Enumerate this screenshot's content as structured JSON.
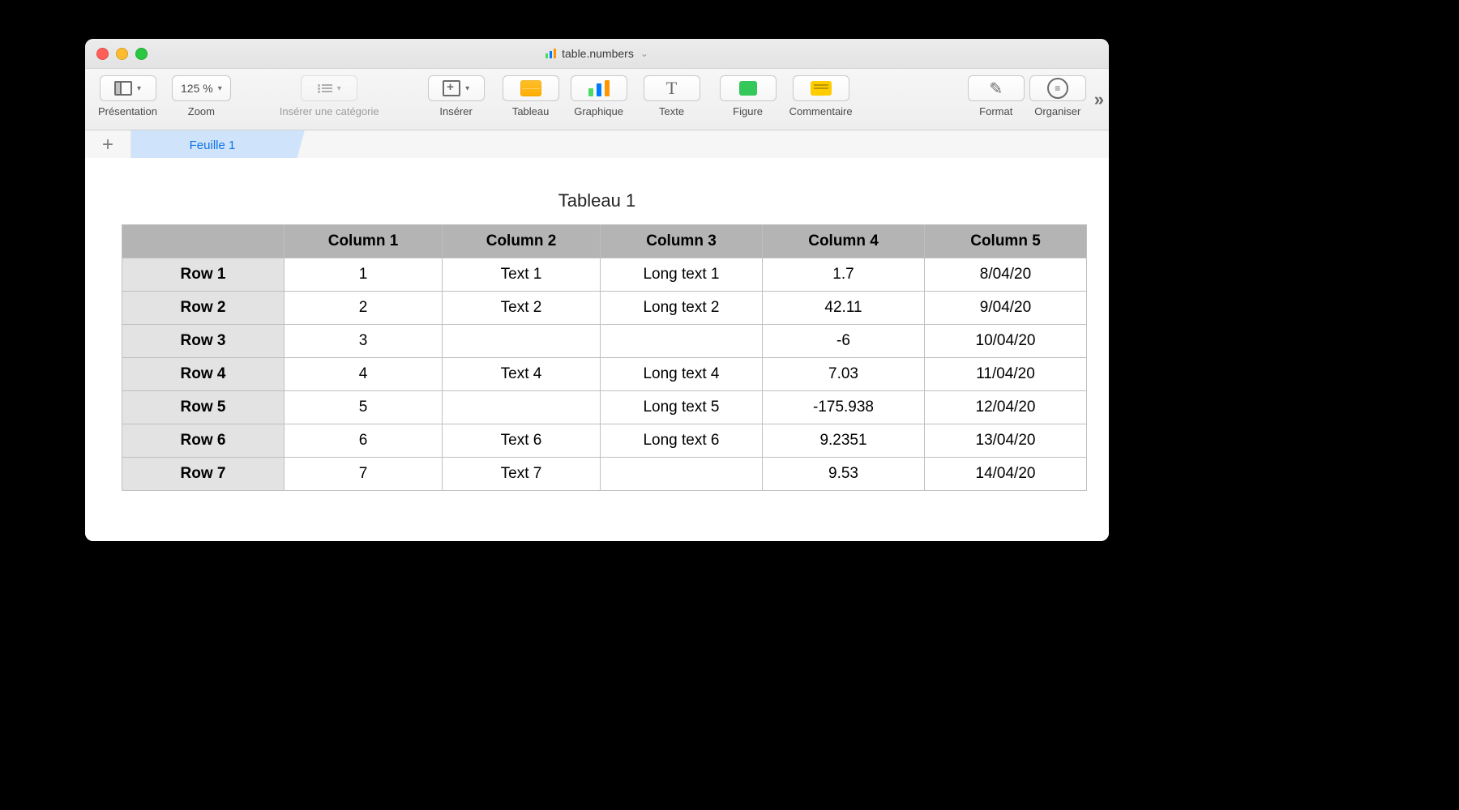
{
  "window": {
    "title": "table.numbers"
  },
  "toolbar": {
    "view": "Présentation",
    "zoom_value": "125 %",
    "zoom_label": "Zoom",
    "category": "Insérer une catégorie",
    "insert": "Insérer",
    "table": "Tableau",
    "chart": "Graphique",
    "text": "Texte",
    "shape": "Figure",
    "comment": "Commentaire",
    "format": "Format",
    "organize": "Organiser"
  },
  "tabs": {
    "sheet1": "Feuille 1"
  },
  "table": {
    "title": "Tableau 1",
    "columns": [
      "Column 1",
      "Column 2",
      "Column 3",
      "Column 4",
      "Column 5"
    ],
    "rows": [
      {
        "label": "Row 1",
        "cells": [
          "1",
          "Text 1",
          "Long text 1",
          "1.7",
          "8/04/20"
        ]
      },
      {
        "label": "Row 2",
        "cells": [
          "2",
          "Text 2",
          "Long text 2",
          "42.11",
          "9/04/20"
        ]
      },
      {
        "label": "Row 3",
        "cells": [
          "3",
          "",
          "",
          "-6",
          "10/04/20"
        ]
      },
      {
        "label": "Row 4",
        "cells": [
          "4",
          "Text 4",
          "Long text 4",
          "7.03",
          "11/04/20"
        ]
      },
      {
        "label": "Row 5",
        "cells": [
          "5",
          "",
          "Long text 5",
          "-175.938",
          "12/04/20"
        ]
      },
      {
        "label": "Row 6",
        "cells": [
          "6",
          "Text 6",
          "Long text 6",
          "9.2351",
          "13/04/20"
        ]
      },
      {
        "label": "Row 7",
        "cells": [
          "7",
          "Text 7",
          "",
          "9.53",
          "14/04/20"
        ]
      }
    ]
  },
  "chart_data": {
    "type": "table",
    "title": "Tableau 1",
    "columns": [
      "",
      "Column 1",
      "Column 2",
      "Column 3",
      "Column 4",
      "Column 5"
    ],
    "rows": [
      [
        "Row 1",
        1,
        "Text 1",
        "Long text 1",
        1.7,
        "8/04/20"
      ],
      [
        "Row 2",
        2,
        "Text 2",
        "Long text 2",
        42.11,
        "9/04/20"
      ],
      [
        "Row 3",
        3,
        "",
        "",
        -6,
        "10/04/20"
      ],
      [
        "Row 4",
        4,
        "Text 4",
        "Long text 4",
        7.03,
        "11/04/20"
      ],
      [
        "Row 5",
        5,
        "",
        "Long text 5",
        -175.938,
        "12/04/20"
      ],
      [
        "Row 6",
        6,
        "Text 6",
        "Long text 6",
        9.2351,
        "13/04/20"
      ],
      [
        "Row 7",
        7,
        "Text 7",
        "",
        9.53,
        "14/04/20"
      ]
    ]
  }
}
